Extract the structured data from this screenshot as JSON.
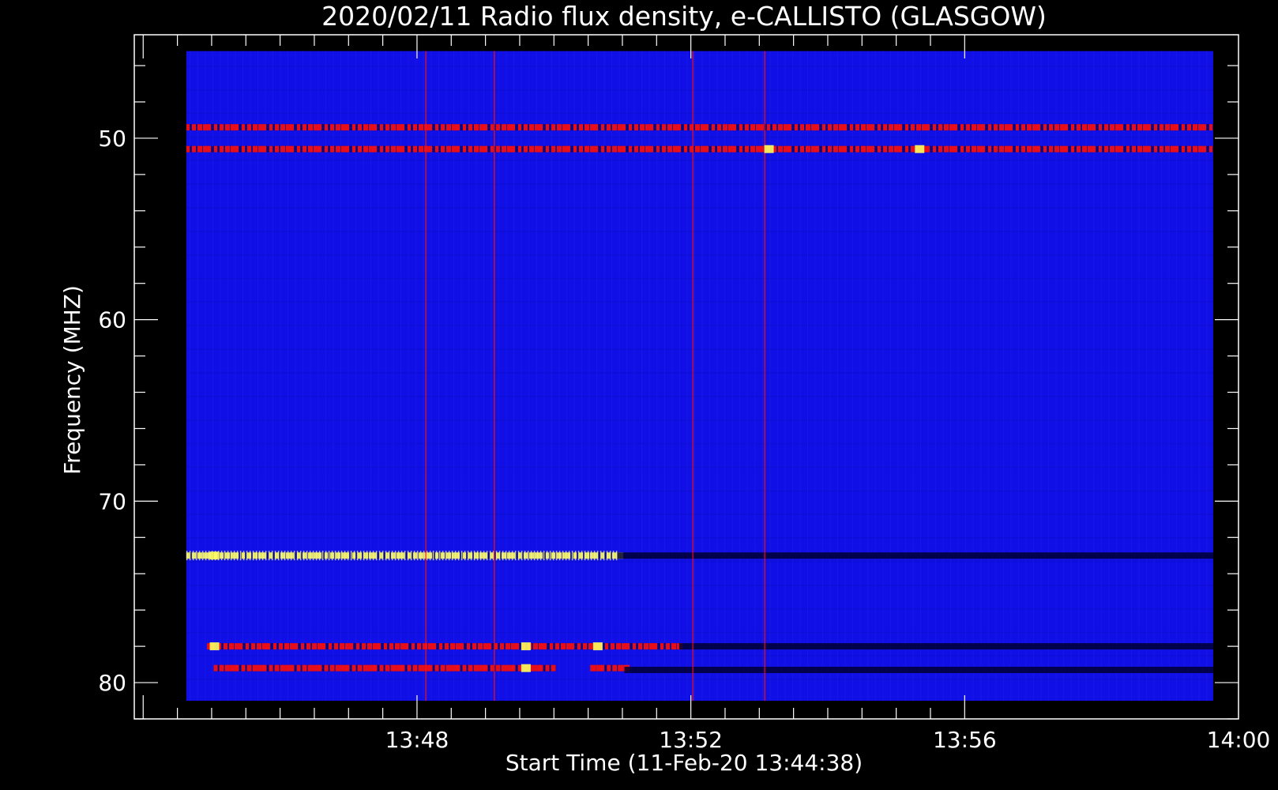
{
  "chart_data": {
    "type": "heatmap",
    "title": "2020/02/11  Radio flux density, e-CALLISTO (GLASGOW)",
    "xlabel": "Start Time (11-Feb-20 13:44:38)",
    "ylabel": "Frequency (MHZ)",
    "x_tick_labels": [
      "13:48",
      "13:52",
      "13:56",
      "14:00"
    ],
    "x_ticks_minutes_after_start": [
      3.37,
      7.37,
      11.37,
      15.37
    ],
    "y_ticks": [
      50,
      60,
      70,
      80
    ],
    "y_inverted": true,
    "xlim_minutes_after_start": [
      -0.76,
      15.37
    ],
    "ylim": [
      44.3,
      82.0
    ],
    "data_extent": {
      "time_minutes_after_start": [
        0,
        15.0
      ],
      "frequency_mhz": [
        45.2,
        81.0
      ]
    },
    "colors": {
      "background": "#1010e6",
      "intensity_low": "#000030",
      "intensity_mid": "#ff1010",
      "intensity_high": "#ffff60"
    },
    "features": [
      {
        "kind": "band",
        "freq_mhz": 49.4,
        "t_start": 0,
        "t_end": 15.0,
        "intensity": "mid"
      },
      {
        "kind": "band",
        "freq_mhz": 50.6,
        "t_start": 0,
        "t_end": 15.0,
        "intensity": "mid"
      },
      {
        "kind": "band",
        "freq_mhz": 73.0,
        "t_start": 0,
        "t_end": 6.3,
        "intensity": "high"
      },
      {
        "kind": "band",
        "freq_mhz": 73.0,
        "t_start": 6.3,
        "t_end": 15.0,
        "intensity": "low"
      },
      {
        "kind": "band",
        "freq_mhz": 78.0,
        "t_start": 0.3,
        "t_end": 7.2,
        "intensity": "mid"
      },
      {
        "kind": "band",
        "freq_mhz": 78.0,
        "t_start": 7.2,
        "t_end": 15.0,
        "intensity": "low"
      },
      {
        "kind": "band",
        "freq_mhz": 79.2,
        "t_start": 0.4,
        "t_end": 5.4,
        "intensity": "mid"
      },
      {
        "kind": "band",
        "freq_mhz": 79.2,
        "t_start": 5.9,
        "t_end": 6.4,
        "intensity": "mid"
      },
      {
        "kind": "band",
        "freq_mhz": 79.3,
        "t_start": 6.4,
        "t_end": 15.0,
        "intensity": "low"
      },
      {
        "kind": "spike",
        "time_minutes": 3.5,
        "intensity": "mid"
      },
      {
        "kind": "spike",
        "time_minutes": 4.5,
        "intensity": "mid"
      },
      {
        "kind": "spike",
        "time_minutes": 7.4,
        "intensity": "mid"
      },
      {
        "kind": "spike",
        "time_minutes": 8.45,
        "intensity": "mid"
      }
    ]
  }
}
